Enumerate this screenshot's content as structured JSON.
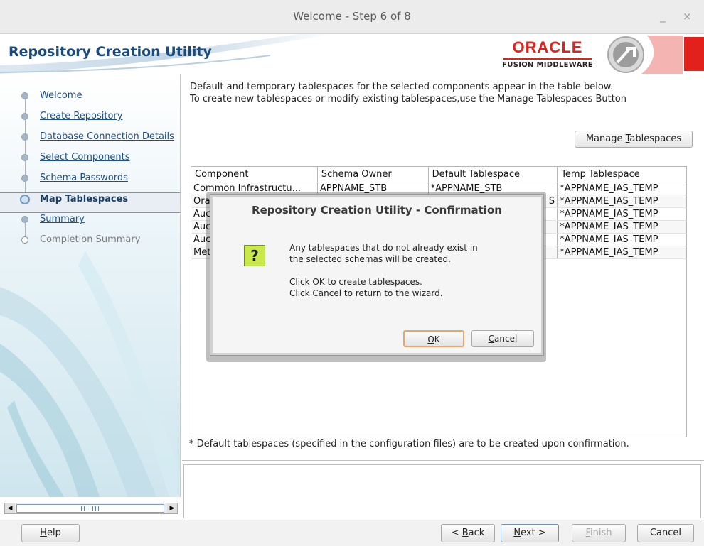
{
  "window": {
    "title": "Welcome - Step 6 of 8",
    "minimize": "_",
    "close": "×"
  },
  "banner": {
    "app_title": "Repository Creation Utility",
    "brand": "ORACLE",
    "brand_sub": "FUSION MIDDLEWARE"
  },
  "sidebar": {
    "items": [
      {
        "label": "Welcome",
        "state": "link"
      },
      {
        "label": "Create Repository",
        "state": "link"
      },
      {
        "label": "Database Connection Details",
        "state": "link"
      },
      {
        "label": "Select Components",
        "state": "link"
      },
      {
        "label": "Schema Passwords",
        "state": "link"
      },
      {
        "label": "Map Tablespaces",
        "state": "current"
      },
      {
        "label": "Summary",
        "state": "link"
      },
      {
        "label": "Completion Summary",
        "state": "disabled"
      }
    ]
  },
  "main": {
    "intro_line1": "Default and temporary tablespaces for the selected components appear in the table below.",
    "intro_line2": "To create new tablespaces or modify existing tablespaces,use the Manage Tablespaces Button",
    "manage_button": {
      "pre": "Manage ",
      "mnemonic": "T",
      "post": "ablespaces"
    },
    "table": {
      "headers": [
        "Component",
        "Schema Owner",
        "Default Tablespace",
        "Temp Tablespace"
      ],
      "rows": [
        [
          "Common Infrastructu...",
          "APPNAME_STB",
          "*APPNAME_STB",
          "*APPNAME_IAS_TEMP"
        ],
        [
          "Ora",
          "",
          "S",
          "*APPNAME_IAS_TEMP"
        ],
        [
          "Auc",
          "",
          "",
          "*APPNAME_IAS_TEMP"
        ],
        [
          "Auc",
          "",
          "",
          "*APPNAME_IAS_TEMP"
        ],
        [
          "Auc",
          "",
          "",
          "*APPNAME_IAS_TEMP"
        ],
        [
          "Met",
          "",
          "",
          "*APPNAME_IAS_TEMP"
        ]
      ]
    },
    "footnote": "* Default tablespaces (specified in the configuration files) are to be created upon confirmation."
  },
  "bottom": {
    "help": {
      "mnemonic": "H",
      "post": "elp"
    },
    "back": {
      "pre": "< ",
      "mnemonic": "B",
      "post": "ack"
    },
    "next": {
      "mnemonic": "N",
      "post": "ext >"
    },
    "finish": {
      "mnemonic": "F",
      "post": "inish"
    },
    "cancel": "Cancel"
  },
  "dialog": {
    "title": "Repository Creation Utility - Confirmation",
    "icon": "?",
    "line1": "Any tablespaces that do not already exist in",
    "line2": "the selected schemas will be created.",
    "line3": "Click OK to create tablespaces.",
    "line4": "Click Cancel to return to the wizard.",
    "ok": {
      "mnemonic": "O",
      "post": "K"
    },
    "cancel": {
      "mnemonic": "C",
      "post": "ancel"
    }
  },
  "colors": {
    "brand_red": "#e2211c",
    "title_blue": "#1a4a7a",
    "link_blue": "#1b4f8a",
    "dialog_icon": "#c9e84a"
  }
}
